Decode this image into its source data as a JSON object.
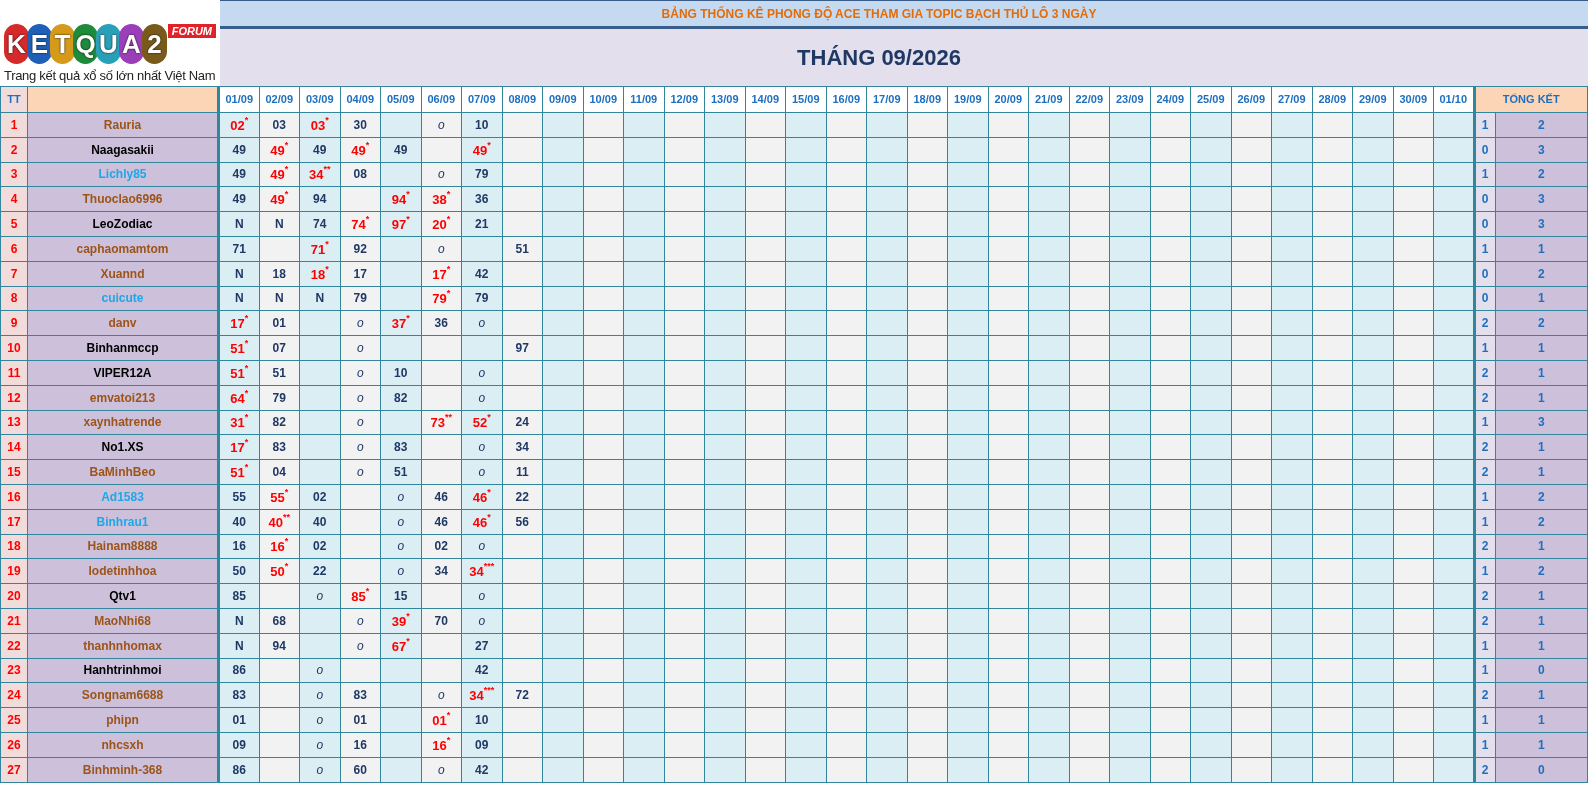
{
  "logo": {
    "letters": [
      "K",
      "E",
      "T",
      "Q",
      "U",
      "A",
      "2"
    ],
    "badge": "FORUM",
    "tagline": "Trang kết quả xổ số lớn nhất Việt Nam"
  },
  "title": "BẢNG THỐNG KÊ PHONG ĐỘ ACE THAM GIA TOPIC BẠCH THỦ LÔ 3 NGÀY",
  "month": "THÁNG 09/2026",
  "table": {
    "columns": {
      "number": "TT",
      "days": [
        "01/09",
        "02/09",
        "03/09",
        "04/09",
        "05/09",
        "06/09",
        "07/09",
        "08/09",
        "09/09",
        "10/09",
        "11/09",
        "12/09",
        "13/09",
        "14/09",
        "15/09",
        "16/09",
        "17/09",
        "18/09",
        "19/09",
        "20/09",
        "21/09",
        "22/09",
        "23/09",
        "24/09",
        "25/09",
        "26/09",
        "27/09",
        "28/09",
        "29/09",
        "30/09",
        "01/10"
      ],
      "summary": "TỔNG KẾT"
    },
    "rows": [
      {
        "number": "1",
        "name": "Rauria",
        "color": "#9c5418",
        "cells": [
          {
            "text": "02",
            "kind": "hit",
            "mark": "*"
          },
          {
            "text": "03",
            "kind": "plain"
          },
          {
            "text": "03",
            "kind": "hit",
            "mark": "*"
          },
          {
            "text": "30",
            "kind": "plain"
          },
          null,
          {
            "text": "o",
            "kind": "skip"
          },
          {
            "text": "10",
            "kind": "plain"
          },
          null
        ],
        "summary": [
          "1",
          "2"
        ]
      },
      {
        "number": "2",
        "name": "Naagasakii",
        "color": "#000000",
        "cells": [
          {
            "text": "49",
            "kind": "plain"
          },
          {
            "text": "49",
            "kind": "hit",
            "mark": "*"
          },
          {
            "text": "49",
            "kind": "plain"
          },
          {
            "text": "49",
            "kind": "hit",
            "mark": "*"
          },
          {
            "text": "49",
            "kind": "plain"
          },
          null,
          {
            "text": "49",
            "kind": "hit",
            "mark": "*"
          },
          null
        ],
        "summary": [
          "0",
          "3"
        ]
      },
      {
        "number": "3",
        "name": "Lichly85",
        "color": "#1ea7e8",
        "cells": [
          {
            "text": "49",
            "kind": "plain"
          },
          {
            "text": "49",
            "kind": "hit",
            "mark": "*"
          },
          {
            "text": "34",
            "kind": "hit",
            "mark": "**"
          },
          {
            "text": "08",
            "kind": "plain"
          },
          null,
          {
            "text": "o",
            "kind": "skip"
          },
          {
            "text": "79",
            "kind": "plain"
          },
          null
        ],
        "summary": [
          "1",
          "2"
        ]
      },
      {
        "number": "4",
        "name": "Thuoclao6996",
        "color": "#9c5418",
        "cells": [
          {
            "text": "49",
            "kind": "plain"
          },
          {
            "text": "49",
            "kind": "hit",
            "mark": "*"
          },
          {
            "text": "94",
            "kind": "plain"
          },
          null,
          {
            "text": "94",
            "kind": "hit",
            "mark": "*"
          },
          {
            "text": "38",
            "kind": "hit",
            "mark": "*"
          },
          {
            "text": "36",
            "kind": "plain"
          },
          null
        ],
        "summary": [
          "0",
          "3"
        ]
      },
      {
        "number": "5",
        "name": "LeoZodiac",
        "color": "#000000",
        "cells": [
          {
            "text": "N",
            "kind": "plain"
          },
          {
            "text": "N",
            "kind": "plain"
          },
          {
            "text": "74",
            "kind": "plain"
          },
          {
            "text": "74",
            "kind": "hit",
            "mark": "*"
          },
          {
            "text": "97",
            "kind": "hit",
            "mark": "*"
          },
          {
            "text": "20",
            "kind": "hit",
            "mark": "*"
          },
          {
            "text": "21",
            "kind": "plain"
          },
          null
        ],
        "summary": [
          "0",
          "3"
        ]
      },
      {
        "number": "6",
        "name": "caphaomamtom",
        "color": "#9c5418",
        "cells": [
          {
            "text": "71",
            "kind": "plain"
          },
          null,
          {
            "text": "71",
            "kind": "hit",
            "mark": "*"
          },
          {
            "text": "92",
            "kind": "plain"
          },
          null,
          {
            "text": "o",
            "kind": "skip"
          },
          null,
          {
            "text": "51",
            "kind": "plain"
          }
        ],
        "summary": [
          "1",
          "1"
        ]
      },
      {
        "number": "7",
        "name": "Xuannd",
        "color": "#9c5418",
        "cells": [
          {
            "text": "N",
            "kind": "plain"
          },
          {
            "text": "18",
            "kind": "plain"
          },
          {
            "text": "18",
            "kind": "hit",
            "mark": "*"
          },
          {
            "text": "17",
            "kind": "plain"
          },
          null,
          {
            "text": "17",
            "kind": "hit",
            "mark": "*"
          },
          {
            "text": "42",
            "kind": "plain"
          },
          null
        ],
        "summary": [
          "0",
          "2"
        ]
      },
      {
        "number": "8",
        "name": "cuicute",
        "color": "#1ea7e8",
        "cells": [
          {
            "text": "N",
            "kind": "plain"
          },
          {
            "text": "N",
            "kind": "plain"
          },
          {
            "text": "N",
            "kind": "plain"
          },
          {
            "text": "79",
            "kind": "plain"
          },
          null,
          {
            "text": "79",
            "kind": "hit",
            "mark": "*"
          },
          {
            "text": "79",
            "kind": "plain"
          },
          null
        ],
        "summary": [
          "0",
          "1"
        ]
      },
      {
        "number": "9",
        "name": "danv",
        "color": "#9c5418",
        "cells": [
          {
            "text": "17",
            "kind": "hit",
            "mark": "*"
          },
          {
            "text": "01",
            "kind": "plain"
          },
          null,
          {
            "text": "o",
            "kind": "skip"
          },
          {
            "text": "37",
            "kind": "hit",
            "mark": "*"
          },
          {
            "text": "36",
            "kind": "plain"
          },
          {
            "text": "o",
            "kind": "skip"
          },
          null
        ],
        "summary": [
          "2",
          "2"
        ]
      },
      {
        "number": "10",
        "name": "Binhanmccp",
        "color": "#000000",
        "cells": [
          {
            "text": "51",
            "kind": "hit",
            "mark": "*"
          },
          {
            "text": "07",
            "kind": "plain"
          },
          null,
          {
            "text": "o",
            "kind": "skip"
          },
          null,
          null,
          null,
          {
            "text": "97",
            "kind": "plain"
          }
        ],
        "summary": [
          "1",
          "1"
        ]
      },
      {
        "number": "11",
        "name": "VIPER12A",
        "color": "#000000",
        "cells": [
          {
            "text": "51",
            "kind": "hit",
            "mark": "*"
          },
          {
            "text": "51",
            "kind": "plain"
          },
          null,
          {
            "text": "o",
            "kind": "skip"
          },
          {
            "text": "10",
            "kind": "plain"
          },
          null,
          {
            "text": "o",
            "kind": "skip"
          },
          null
        ],
        "summary": [
          "2",
          "1"
        ]
      },
      {
        "number": "12",
        "name": "emvatoi213",
        "color": "#9c5418",
        "cells": [
          {
            "text": "64",
            "kind": "hit",
            "mark": "*"
          },
          {
            "text": "79",
            "kind": "plain"
          },
          null,
          {
            "text": "o",
            "kind": "skip"
          },
          {
            "text": "82",
            "kind": "plain"
          },
          null,
          {
            "text": "o",
            "kind": "skip"
          },
          null
        ],
        "summary": [
          "2",
          "1"
        ]
      },
      {
        "number": "13",
        "name": "xaynhatrende",
        "color": "#9c5418",
        "cells": [
          {
            "text": "31",
            "kind": "hit",
            "mark": "*"
          },
          {
            "text": "82",
            "kind": "plain"
          },
          null,
          {
            "text": "o",
            "kind": "skip"
          },
          null,
          {
            "text": "73",
            "kind": "hit",
            "mark": "**"
          },
          {
            "text": "52",
            "kind": "hit",
            "mark": "*"
          },
          {
            "text": "24",
            "kind": "plain"
          }
        ],
        "summary": [
          "1",
          "3"
        ]
      },
      {
        "number": "14",
        "name": "No1.XS",
        "color": "#000000",
        "cells": [
          {
            "text": "17",
            "kind": "hit",
            "mark": "*"
          },
          {
            "text": "83",
            "kind": "plain"
          },
          null,
          {
            "text": "o",
            "kind": "skip"
          },
          {
            "text": "83",
            "kind": "plain"
          },
          null,
          {
            "text": "o",
            "kind": "skip"
          },
          {
            "text": "34",
            "kind": "plain"
          }
        ],
        "summary": [
          "2",
          "1"
        ]
      },
      {
        "number": "15",
        "name": "BaMinhBeo",
        "color": "#9c5418",
        "cells": [
          {
            "text": "51",
            "kind": "hit",
            "mark": "*"
          },
          {
            "text": "04",
            "kind": "plain"
          },
          null,
          {
            "text": "o",
            "kind": "skip"
          },
          {
            "text": "51",
            "kind": "plain"
          },
          null,
          {
            "text": "o",
            "kind": "skip"
          },
          {
            "text": "11",
            "kind": "plain"
          }
        ],
        "summary": [
          "2",
          "1"
        ]
      },
      {
        "number": "16",
        "name": "Ad1583",
        "color": "#1ea7e8",
        "cells": [
          {
            "text": "55",
            "kind": "plain"
          },
          {
            "text": "55",
            "kind": "hit",
            "mark": "*"
          },
          {
            "text": "02",
            "kind": "plain"
          },
          null,
          {
            "text": "o",
            "kind": "skip"
          },
          {
            "text": "46",
            "kind": "plain"
          },
          {
            "text": "46",
            "kind": "hit",
            "mark": "*"
          },
          {
            "text": "22",
            "kind": "plain"
          }
        ],
        "summary": [
          "1",
          "2"
        ]
      },
      {
        "number": "17",
        "name": "Binhrau1",
        "color": "#1ea7e8",
        "cells": [
          {
            "text": "40",
            "kind": "plain"
          },
          {
            "text": "40",
            "kind": "hit",
            "mark": "**"
          },
          {
            "text": "40",
            "kind": "plain"
          },
          null,
          {
            "text": "o",
            "kind": "skip"
          },
          {
            "text": "46",
            "kind": "plain"
          },
          {
            "text": "46",
            "kind": "hit",
            "mark": "*"
          },
          {
            "text": "56",
            "kind": "plain"
          }
        ],
        "summary": [
          "1",
          "2"
        ]
      },
      {
        "number": "18",
        "name": "Hainam8888",
        "color": "#9c5418",
        "cells": [
          {
            "text": "16",
            "kind": "plain"
          },
          {
            "text": "16",
            "kind": "hit",
            "mark": "*"
          },
          {
            "text": "02",
            "kind": "plain"
          },
          null,
          {
            "text": "o",
            "kind": "skip"
          },
          {
            "text": "02",
            "kind": "plain"
          },
          {
            "text": "o",
            "kind": "skip"
          },
          null
        ],
        "summary": [
          "2",
          "1"
        ]
      },
      {
        "number": "19",
        "name": "lodetinhhoa",
        "color": "#9c5418",
        "cells": [
          {
            "text": "50",
            "kind": "plain"
          },
          {
            "text": "50",
            "kind": "hit",
            "mark": "*"
          },
          {
            "text": "22",
            "kind": "plain"
          },
          null,
          {
            "text": "o",
            "kind": "skip"
          },
          {
            "text": "34",
            "kind": "plain"
          },
          {
            "text": "34",
            "kind": "hit",
            "mark": "***"
          },
          null
        ],
        "summary": [
          "1",
          "2"
        ]
      },
      {
        "number": "20",
        "name": "Qtv1",
        "color": "#000000",
        "cells": [
          {
            "text": "85",
            "kind": "plain"
          },
          null,
          {
            "text": "o",
            "kind": "skip"
          },
          {
            "text": "85",
            "kind": "hit",
            "mark": "*"
          },
          {
            "text": "15",
            "kind": "plain"
          },
          null,
          {
            "text": "o",
            "kind": "skip"
          },
          null
        ],
        "summary": [
          "2",
          "1"
        ]
      },
      {
        "number": "21",
        "name": "MaoNhi68",
        "color": "#9c5418",
        "cells": [
          {
            "text": "N",
            "kind": "plain"
          },
          {
            "text": "68",
            "kind": "plain"
          },
          null,
          {
            "text": "o",
            "kind": "skip"
          },
          {
            "text": "39",
            "kind": "hit",
            "mark": "*"
          },
          {
            "text": "70",
            "kind": "plain"
          },
          {
            "text": "o",
            "kind": "skip"
          },
          null
        ],
        "summary": [
          "2",
          "1"
        ]
      },
      {
        "number": "22",
        "name": "thanhnhomax",
        "color": "#9c5418",
        "cells": [
          {
            "text": "N",
            "kind": "plain"
          },
          {
            "text": "94",
            "kind": "plain"
          },
          null,
          {
            "text": "o",
            "kind": "skip"
          },
          {
            "text": "67",
            "kind": "hit",
            "mark": "*"
          },
          null,
          {
            "text": "27",
            "kind": "plain"
          },
          null
        ],
        "summary": [
          "1",
          "1"
        ]
      },
      {
        "number": "23",
        "name": "Hanhtrinhmoi",
        "color": "#000000",
        "cells": [
          {
            "text": "86",
            "kind": "plain"
          },
          null,
          {
            "text": "o",
            "kind": "skip"
          },
          null,
          null,
          null,
          {
            "text": "42",
            "kind": "plain"
          },
          null
        ],
        "summary": [
          "1",
          "0"
        ]
      },
      {
        "number": "24",
        "name": "Songnam6688",
        "color": "#9c5418",
        "cells": [
          {
            "text": "83",
            "kind": "plain"
          },
          null,
          {
            "text": "o",
            "kind": "skip"
          },
          {
            "text": "83",
            "kind": "plain"
          },
          null,
          {
            "text": "o",
            "kind": "skip"
          },
          {
            "text": "34",
            "kind": "hit",
            "mark": "***"
          },
          {
            "text": "72",
            "kind": "plain"
          }
        ],
        "summary": [
          "2",
          "1"
        ]
      },
      {
        "number": "25",
        "name": "phipn",
        "color": "#9c5418",
        "cells": [
          {
            "text": "01",
            "kind": "plain"
          },
          null,
          {
            "text": "o",
            "kind": "skip"
          },
          {
            "text": "01",
            "kind": "plain"
          },
          null,
          {
            "text": "01",
            "kind": "hit",
            "mark": "*"
          },
          {
            "text": "10",
            "kind": "plain"
          },
          null
        ],
        "summary": [
          "1",
          "1"
        ]
      },
      {
        "number": "26",
        "name": "nhcsxh",
        "color": "#9c5418",
        "cells": [
          {
            "text": "09",
            "kind": "plain"
          },
          null,
          {
            "text": "o",
            "kind": "skip"
          },
          {
            "text": "16",
            "kind": "plain"
          },
          null,
          {
            "text": "16",
            "kind": "hit",
            "mark": "*"
          },
          {
            "text": "09",
            "kind": "plain"
          },
          null
        ],
        "summary": [
          "1",
          "1"
        ]
      },
      {
        "number": "27",
        "name": "Binhminh-368",
        "color": "#9c5418",
        "cells": [
          {
            "text": "86",
            "kind": "plain"
          },
          null,
          {
            "text": "o",
            "kind": "skip"
          },
          {
            "text": "60",
            "kind": "plain"
          },
          null,
          {
            "text": "o",
            "kind": "skip"
          },
          {
            "text": "42",
            "kind": "plain"
          },
          null
        ],
        "summary": [
          "2",
          "0"
        ]
      }
    ]
  }
}
